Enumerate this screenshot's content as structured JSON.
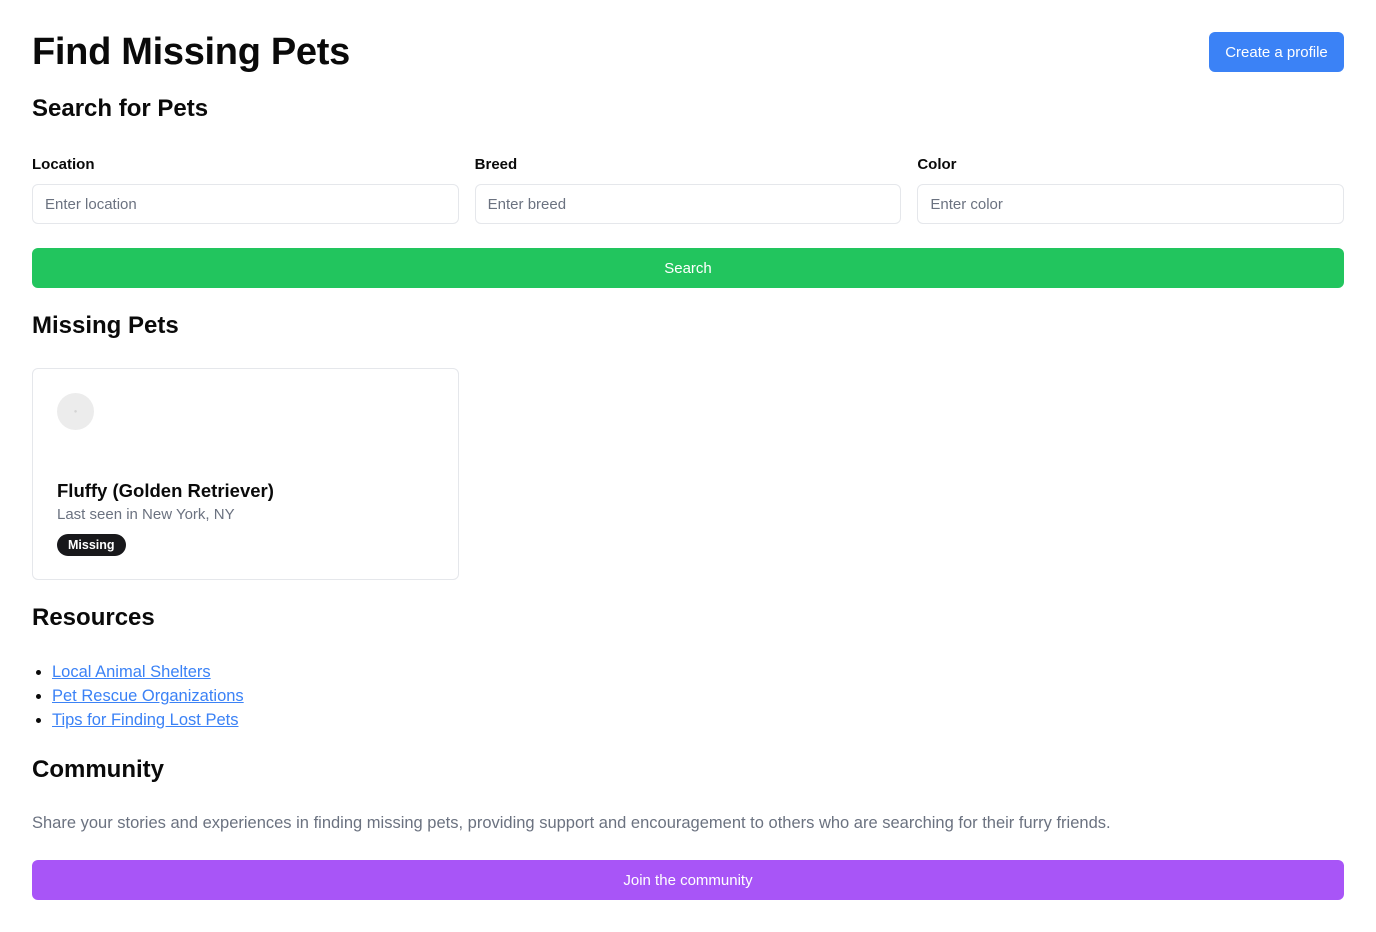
{
  "header": {
    "title": "Find Missing Pets",
    "create_profile_label": "Create a profile"
  },
  "search": {
    "title": "Search for Pets",
    "location_label": "Location",
    "location_placeholder": "Enter location",
    "breed_label": "Breed",
    "breed_placeholder": "Enter breed",
    "color_label": "Color",
    "color_placeholder": "Enter color",
    "search_label": "Search"
  },
  "missing": {
    "title": "Missing Pets",
    "pets": [
      {
        "name": "Fluffy (Golden Retriever)",
        "last_seen": "Last seen in New York, NY",
        "status": "Missing"
      }
    ]
  },
  "resources": {
    "title": "Resources",
    "links": [
      "Local Animal Shelters",
      "Pet Rescue Organizations",
      "Tips for Finding Lost Pets"
    ]
  },
  "community": {
    "title": "Community",
    "description": "Share your stories and experiences in finding missing pets, providing support and encouragement to others who are searching for their furry friends.",
    "join_label": "Join the community"
  },
  "colors": {
    "primary_blue": "#3b82f6",
    "search_green": "#22c55e",
    "community_purple": "#a855f7",
    "badge_dark": "#18181b"
  }
}
